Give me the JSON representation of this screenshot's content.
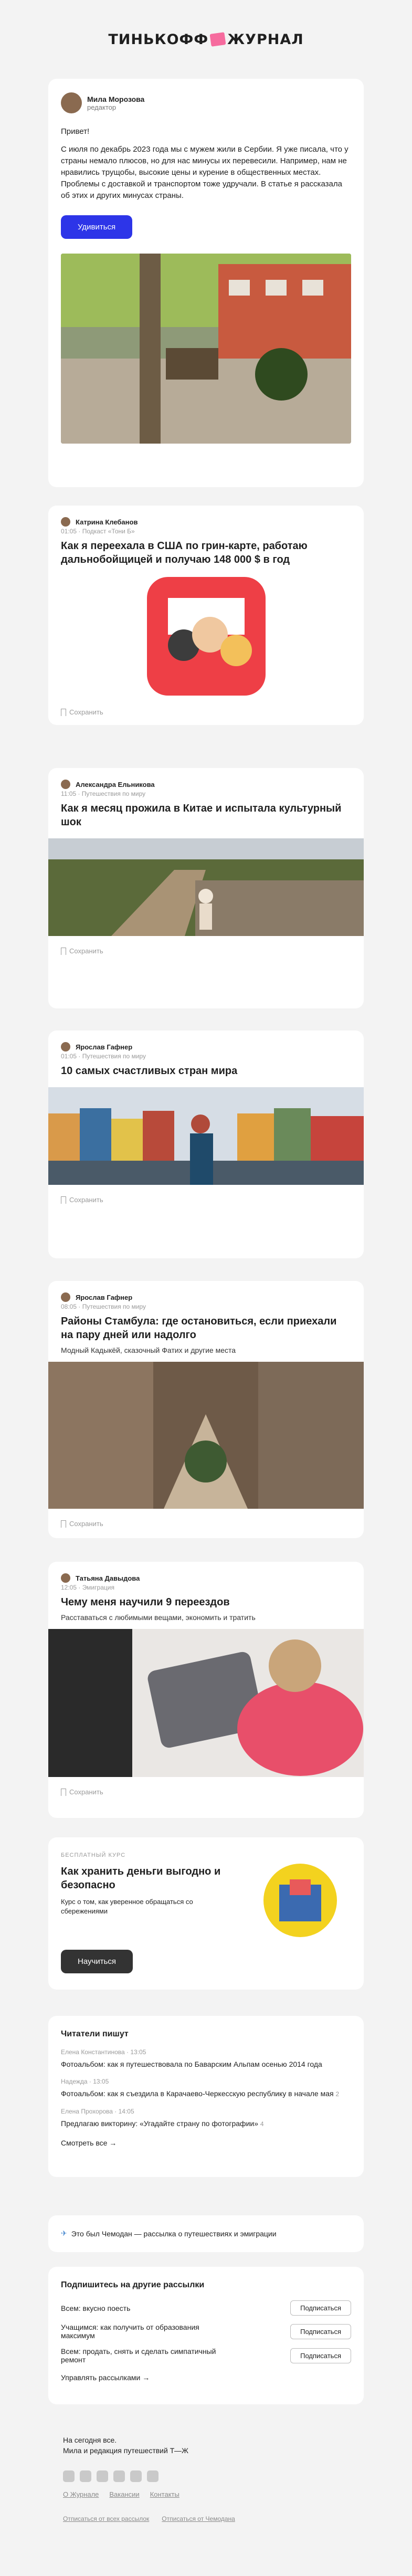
{
  "header": {
    "logo_left": "ТИНЬКОФФ",
    "logo_right": "ЖУРНАЛ"
  },
  "letter": {
    "author": "Мила Морозова",
    "role": "редактор",
    "greeting": "Привет!",
    "body": "С июля по декабрь 2023 года мы с мужем жили в Сербии. Я уже писала, что у страны немало плюсов, но для нас минусы их перевесили. Например, нам не нравились трущобы, высокие цены и курение в общественных местах. Проблемы с доставкой и транспортом тоже удручали. В статье я рассказала об этих и других минусах страны.",
    "button": "Удивиться"
  },
  "articles": [
    {
      "author": "Катрина Клебанов",
      "meta": "01:05 · Подкаст «Тони Б»",
      "title": "Как я переехала в США по грин-карте, работаю дальнобойщицей и получаю 148 000 $ в год",
      "subtitle": "",
      "save": "Сохранить"
    },
    {
      "author": "Александра Ельникова",
      "meta": "11:05 · Путешествия по миру",
      "title": "Как я месяц прожила в Китае и испытала культурный шок",
      "subtitle": "",
      "save": "Сохранить"
    },
    {
      "author": "Ярослав Гафнер",
      "meta": "01:05 · Путешествия по миру",
      "title": "10 самых счастливых стран мира",
      "subtitle": "",
      "save": "Сохранить"
    },
    {
      "author": "Ярослав Гафнер",
      "meta": "08:05 · Путешествия по миру",
      "title": "Районы Стамбула: где остановиться, если приехали на пару дней или надолго",
      "subtitle": "Модный Кадыкёй, сказочный Фатих и другие места",
      "save": "Сохранить"
    },
    {
      "author": "Татьяна Давыдова",
      "meta": "12:05 · Эмиграция",
      "title": "Чему меня научили 9 переездов",
      "subtitle": "Расставаться с любимыми вещами, экономить и тратить",
      "save": "Сохранить"
    }
  ],
  "course": {
    "label": "БЕСПЛАТНЫЙ КУРС",
    "title": "Как хранить деньги выгодно и безопасно",
    "desc": "Курс о том, как уверенное обращаться со сбережениями",
    "button": "Научиться"
  },
  "readers": {
    "heading": "Читатели пишут",
    "items": [
      {
        "who": "Елена Константинова · 13:05",
        "text": "Фотоальбом: как я путешествовала по Баварским Альпам осенью 2014 года",
        "count": ""
      },
      {
        "who": "Надежда · 13:05",
        "text": "Фотоальбом: как я съездила в Карачаево-Черкесскую республику в начале мая",
        "count": "2"
      },
      {
        "who": "Елена Прохорова · 14:05",
        "text": "Предлагаю викторину: «Угадайте страну по фотографии»",
        "count": "4"
      }
    ],
    "more": "Смотреть все →"
  },
  "info": {
    "text": "Это был Чемодан — рассылка о путешествиях и эмиграции"
  },
  "subs": {
    "heading": "Подпишитесь на другие рассылки",
    "items": [
      {
        "text": "Всем: вкусно поесть",
        "btn": "Подписаться"
      },
      {
        "text": "Учащимся: как получить от образования максимум",
        "btn": "Подписаться"
      },
      {
        "text": "Всем: продать, снять и сделать симпатичный ремонт",
        "btn": "Подписаться"
      }
    ],
    "manage": "Управлять рассылками →"
  },
  "footer": {
    "line1": "На сегодня все.",
    "line2": "Мила и редакция путешествий Т—Ж",
    "links": [
      "О Журнале",
      "Вакансии",
      "Контакты"
    ],
    "unsub_all": "Отписаться от всех рассылок",
    "unsub_this": "Отписаться от Чемодана"
  }
}
